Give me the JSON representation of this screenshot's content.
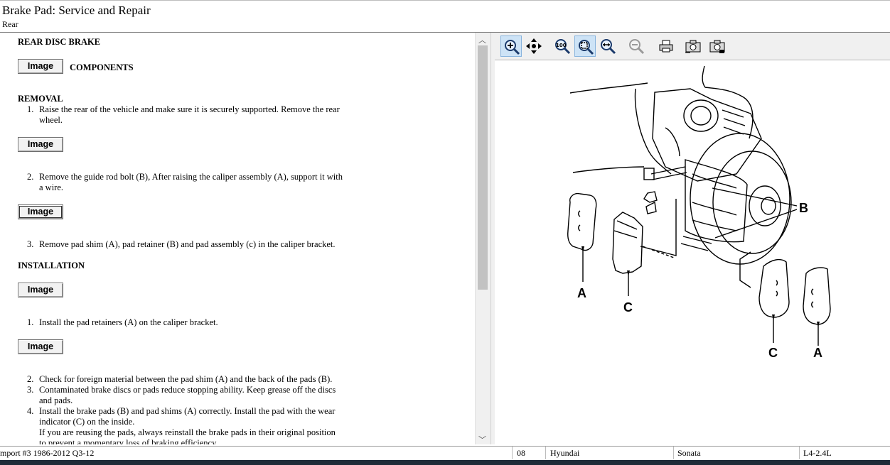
{
  "header": {
    "title": "Brake Pad:  Service and Repair",
    "subtitle": "Rear"
  },
  "content": {
    "heading_main": "REAR DISC BRAKE",
    "image_button_label": "Image",
    "components_label": "COMPONENTS",
    "removal_heading": "REMOVAL",
    "removal_steps": [
      {
        "num": "1.",
        "lines": [
          "Raise the rear of the vehicle and make sure it is securely supported. Remove the rear",
          "wheel."
        ]
      },
      {
        "num": "2.",
        "lines": [
          "Remove the guide rod bolt (B), After raising the caliper assembly (A), support it with",
          "a wire."
        ]
      },
      {
        "num": "3.",
        "lines": [
          "Remove pad shim (A), pad retainer (B) and pad assembly (c) in the caliper bracket."
        ]
      }
    ],
    "installation_heading": "INSTALLATION",
    "installation_steps": [
      {
        "num": "1.",
        "lines": [
          "Install the pad retainers (A) on the caliper bracket."
        ]
      },
      {
        "num": "2.",
        "lines": [
          "Check for foreign material between the pad shim (A) and the back of the pads (B)."
        ]
      },
      {
        "num": "3.",
        "lines": [
          "Contaminated brake discs or pads reduce stopping ability. Keep grease off the discs",
          "and pads."
        ]
      },
      {
        "num": "4.",
        "lines": [
          "Install the brake pads (B) and pad shims (A) correctly. Install the pad with the wear",
          "indicator (C) on the inside.",
          "If you are reusing the pads, always reinstall the brake pads in their original position",
          "to prevent a momentary loss of braking efficiency."
        ]
      }
    ]
  },
  "toolbar": {
    "buttons": [
      {
        "name": "zoom-in-tool-button",
        "icon": "zoom-in-icon",
        "selected": true
      },
      {
        "name": "pan-tool-button",
        "icon": "pan-icon",
        "selected": false
      },
      {
        "name": "actual-size-button",
        "icon": "actual-size-100-icon",
        "selected": false
      },
      {
        "name": "zoom-fit-button",
        "icon": "zoom-fit-icon",
        "selected": true
      },
      {
        "name": "zoom-width-button",
        "icon": "zoom-width-icon",
        "selected": false
      },
      {
        "name": "zoom-out-button",
        "icon": "zoom-out-icon",
        "selected": false
      },
      {
        "name": "print-button",
        "icon": "printer-icon",
        "selected": false
      },
      {
        "name": "copy-image-button",
        "icon": "camera-icon",
        "selected": false
      },
      {
        "name": "save-image-button",
        "icon": "camera-save-icon",
        "selected": false
      }
    ]
  },
  "diagram": {
    "callouts": [
      "B",
      "A",
      "C",
      "C",
      "A"
    ]
  },
  "status": {
    "source": "mport #3 1986-2012 Q3-12",
    "year": "08",
    "make": "Hyundai",
    "model": "Sonata",
    "engine": "L4-2.4L"
  },
  "colors": {
    "toolbar_bg": "#f0f0f0",
    "toolbar_selected": "#cde3f6",
    "taskbar": "#1e2c38"
  }
}
